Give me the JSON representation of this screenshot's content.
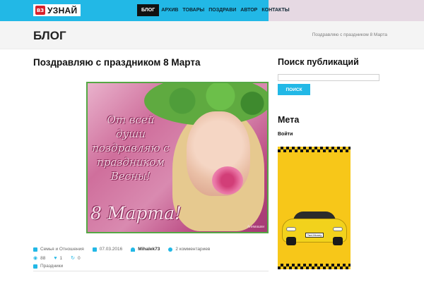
{
  "header": {
    "logo_badge": "ВЗ",
    "logo_text": "УЗНАЙ",
    "nav": [
      {
        "label": "БЛОГ",
        "active": true
      },
      {
        "label": "АРХИВ",
        "active": false
      },
      {
        "label": "ТОВАРЫ",
        "active": false
      },
      {
        "label": "ПОЗДРАВИ",
        "active": false
      },
      {
        "label": "АВТОР",
        "active": false
      },
      {
        "label": "КОНТАКТЫ",
        "active": false
      }
    ],
    "colors": {
      "bar": "#22b8e6",
      "side": "#e6d9e3"
    }
  },
  "page": {
    "title": "БЛОГ",
    "breadcrumb": "Поздравляю с праздником 8 Марта"
  },
  "post": {
    "title": "Поздравляю с праздником 8 Марта",
    "image": {
      "greeting": "От всей души поздравляю с праздником Весны!",
      "march": "8 Марта!",
      "watermark": "Анимашки"
    },
    "meta": {
      "category": "Семья и Отношения",
      "date": "07.03.2016",
      "author": "Mihalek73",
      "comments": "2 комментариев",
      "views": "88",
      "likes": "1",
      "shares": "0",
      "tag": "Праздники"
    }
  },
  "sidebar": {
    "search_title": "Поиск публикаций",
    "search_placeholder": "",
    "search_button": "ПОИСК",
    "meta_title": "Мета",
    "login": "Войти",
    "ad_plate": "Taxi-Money"
  }
}
